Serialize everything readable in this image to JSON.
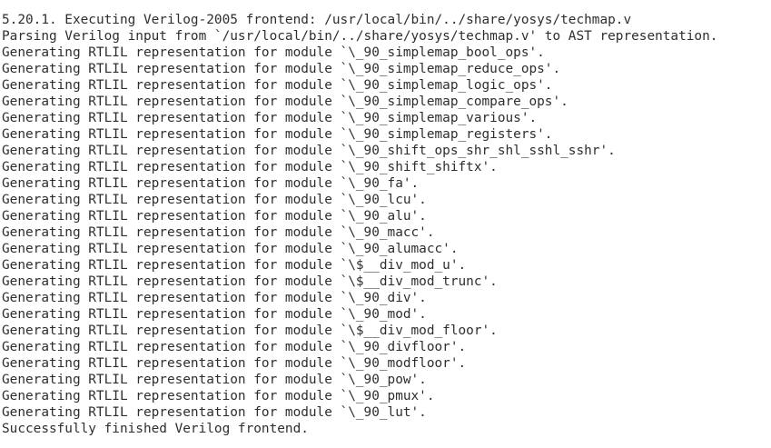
{
  "terminal": {
    "lines": [
      "5.20.1. Executing Verilog-2005 frontend: /usr/local/bin/../share/yosys/techmap.v",
      "Parsing Verilog input from `/usr/local/bin/../share/yosys/techmap.v' to AST representation.",
      "Generating RTLIL representation for module `\\_90_simplemap_bool_ops'.",
      "Generating RTLIL representation for module `\\_90_simplemap_reduce_ops'.",
      "Generating RTLIL representation for module `\\_90_simplemap_logic_ops'.",
      "Generating RTLIL representation for module `\\_90_simplemap_compare_ops'.",
      "Generating RTLIL representation for module `\\_90_simplemap_various'.",
      "Generating RTLIL representation for module `\\_90_simplemap_registers'.",
      "Generating RTLIL representation for module `\\_90_shift_ops_shr_shl_sshl_sshr'.",
      "Generating RTLIL representation for module `\\_90_shift_shiftx'.",
      "Generating RTLIL representation for module `\\_90_fa'.",
      "Generating RTLIL representation for module `\\_90_lcu'.",
      "Generating RTLIL representation for module `\\_90_alu'.",
      "Generating RTLIL representation for module `\\_90_macc'.",
      "Generating RTLIL representation for module `\\_90_alumacc'.",
      "Generating RTLIL representation for module `\\$__div_mod_u'.",
      "Generating RTLIL representation for module `\\$__div_mod_trunc'.",
      "Generating RTLIL representation for module `\\_90_div'.",
      "Generating RTLIL representation for module `\\_90_mod'.",
      "Generating RTLIL representation for module `\\$__div_mod_floor'.",
      "Generating RTLIL representation for module `\\_90_divfloor'.",
      "Generating RTLIL representation for module `\\_90_modfloor'.",
      "Generating RTLIL representation for module `\\_90_pow'.",
      "Generating RTLIL representation for module `\\_90_pmux'.",
      "Generating RTLIL representation for module `\\_90_lut'.",
      "Successfully finished Verilog frontend."
    ]
  }
}
